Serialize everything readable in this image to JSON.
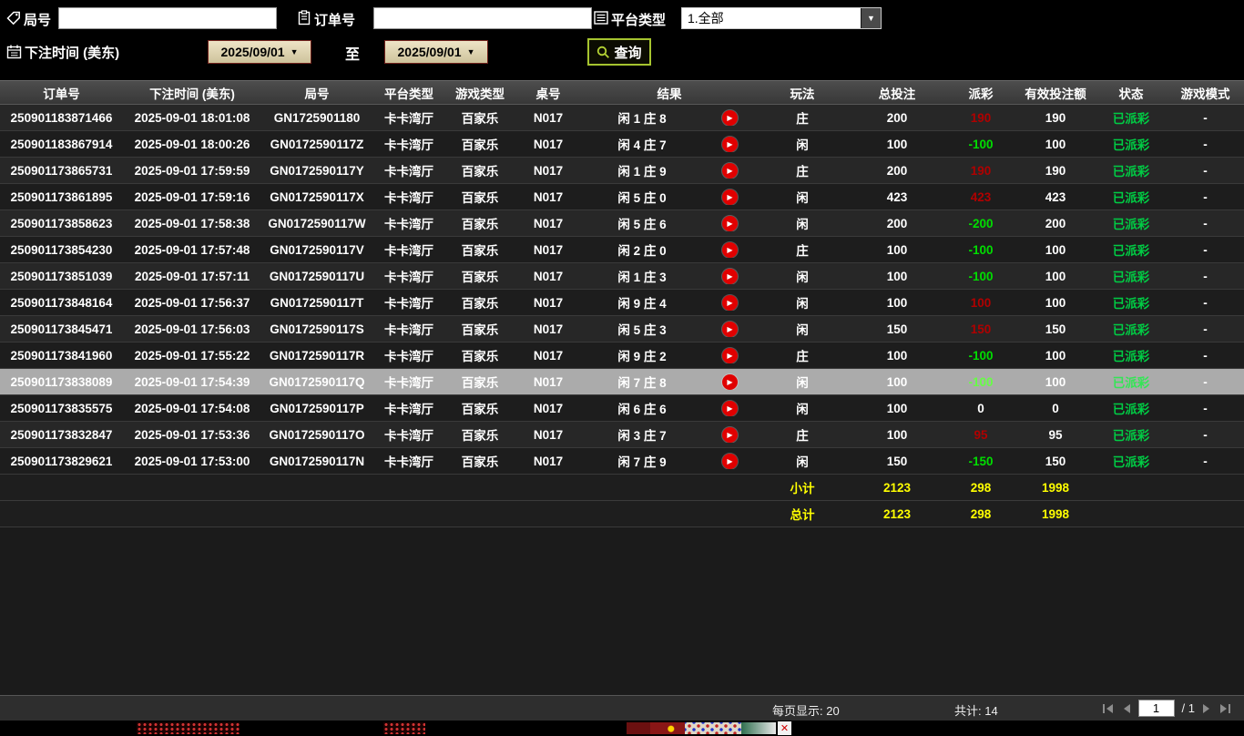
{
  "filters": {
    "round_label": "局号",
    "round_value": "",
    "order_label": "订单号",
    "order_value": "",
    "platform_label": "平台类型",
    "platform_value": "1.全部",
    "bet_time_label": "下注时间 (美东)",
    "date_from": "2025/09/01",
    "to_label": "至",
    "date_to": "2025/09/01",
    "search_label": "查询"
  },
  "icons": {
    "dropdown": "▼",
    "play": "▶",
    "close": "✕"
  },
  "table": {
    "headers": [
      "订单号",
      "下注时间 (美东)",
      "局号",
      "平台类型",
      "游戏类型",
      "桌号",
      "结果",
      "玩法",
      "总投注",
      "派彩",
      "有效投注额",
      "状态",
      "游戏模式"
    ],
    "rows": [
      {
        "order_no": "250901183871466",
        "bet_time": "2025-09-01 18:01:08",
        "round_no": "GN1725901180",
        "platform": "卡卡湾厅",
        "game": "百家乐",
        "table_no": "N017",
        "result": "闲 1 庄 8",
        "play": "庄",
        "total_bet": "200",
        "payout": "190",
        "payout_color": "red",
        "valid_bet": "190",
        "status": "已派彩",
        "mode": "-",
        "selected": false
      },
      {
        "order_no": "250901183867914",
        "bet_time": "2025-09-01 18:00:26",
        "round_no": "GN0172590117Z",
        "platform": "卡卡湾厅",
        "game": "百家乐",
        "table_no": "N017",
        "result": "闲 4 庄 7",
        "play": "闲",
        "total_bet": "100",
        "payout": "-100",
        "payout_color": "green",
        "valid_bet": "100",
        "status": "已派彩",
        "mode": "-",
        "selected": false
      },
      {
        "order_no": "250901173865731",
        "bet_time": "2025-09-01 17:59:59",
        "round_no": "GN0172590117Y",
        "platform": "卡卡湾厅",
        "game": "百家乐",
        "table_no": "N017",
        "result": "闲 1 庄 9",
        "play": "庄",
        "total_bet": "200",
        "payout": "190",
        "payout_color": "red",
        "valid_bet": "190",
        "status": "已派彩",
        "mode": "-",
        "selected": false
      },
      {
        "order_no": "250901173861895",
        "bet_time": "2025-09-01 17:59:16",
        "round_no": "GN0172590117X",
        "platform": "卡卡湾厅",
        "game": "百家乐",
        "table_no": "N017",
        "result": "闲 5 庄 0",
        "play": "闲",
        "total_bet": "423",
        "payout": "423",
        "payout_color": "red",
        "valid_bet": "423",
        "status": "已派彩",
        "mode": "-",
        "selected": false
      },
      {
        "order_no": "250901173858623",
        "bet_time": "2025-09-01 17:58:38",
        "round_no": "GN0172590117W",
        "platform": "卡卡湾厅",
        "game": "百家乐",
        "table_no": "N017",
        "result": "闲 5 庄 6",
        "play": "闲",
        "total_bet": "200",
        "payout": "-200",
        "payout_color": "green",
        "valid_bet": "200",
        "status": "已派彩",
        "mode": "-",
        "selected": false
      },
      {
        "order_no": "250901173854230",
        "bet_time": "2025-09-01 17:57:48",
        "round_no": "GN0172590117V",
        "platform": "卡卡湾厅",
        "game": "百家乐",
        "table_no": "N017",
        "result": "闲 2 庄 0",
        "play": "庄",
        "total_bet": "100",
        "payout": "-100",
        "payout_color": "green",
        "valid_bet": "100",
        "status": "已派彩",
        "mode": "-",
        "selected": false
      },
      {
        "order_no": "250901173851039",
        "bet_time": "2025-09-01 17:57:11",
        "round_no": "GN0172590117U",
        "platform": "卡卡湾厅",
        "game": "百家乐",
        "table_no": "N017",
        "result": "闲 1 庄 3",
        "play": "闲",
        "total_bet": "100",
        "payout": "-100",
        "payout_color": "green",
        "valid_bet": "100",
        "status": "已派彩",
        "mode": "-",
        "selected": false
      },
      {
        "order_no": "250901173848164",
        "bet_time": "2025-09-01 17:56:37",
        "round_no": "GN0172590117T",
        "platform": "卡卡湾厅",
        "game": "百家乐",
        "table_no": "N017",
        "result": "闲 9 庄 4",
        "play": "闲",
        "total_bet": "100",
        "payout": "100",
        "payout_color": "red",
        "valid_bet": "100",
        "status": "已派彩",
        "mode": "-",
        "selected": false
      },
      {
        "order_no": "250901173845471",
        "bet_time": "2025-09-01 17:56:03",
        "round_no": "GN0172590117S",
        "platform": "卡卡湾厅",
        "game": "百家乐",
        "table_no": "N017",
        "result": "闲 5 庄 3",
        "play": "闲",
        "total_bet": "150",
        "payout": "150",
        "payout_color": "red",
        "valid_bet": "150",
        "status": "已派彩",
        "mode": "-",
        "selected": false
      },
      {
        "order_no": "250901173841960",
        "bet_time": "2025-09-01 17:55:22",
        "round_no": "GN0172590117R",
        "platform": "卡卡湾厅",
        "game": "百家乐",
        "table_no": "N017",
        "result": "闲 9 庄 2",
        "play": "庄",
        "total_bet": "100",
        "payout": "-100",
        "payout_color": "green",
        "valid_bet": "100",
        "status": "已派彩",
        "mode": "-",
        "selected": false
      },
      {
        "order_no": "250901173838089",
        "bet_time": "2025-09-01 17:54:39",
        "round_no": "GN0172590117Q",
        "platform": "卡卡湾厅",
        "game": "百家乐",
        "table_no": "N017",
        "result": "闲 7 庄 8",
        "play": "闲",
        "total_bet": "100",
        "payout": "-100",
        "payout_color": "green",
        "valid_bet": "100",
        "status": "已派彩",
        "mode": "-",
        "selected": true
      },
      {
        "order_no": "250901173835575",
        "bet_time": "2025-09-01 17:54:08",
        "round_no": "GN0172590117P",
        "platform": "卡卡湾厅",
        "game": "百家乐",
        "table_no": "N017",
        "result": "闲 6 庄 6",
        "play": "闲",
        "total_bet": "100",
        "payout": "0",
        "payout_color": "white",
        "valid_bet": "0",
        "status": "已派彩",
        "mode": "-",
        "selected": false
      },
      {
        "order_no": "250901173832847",
        "bet_time": "2025-09-01 17:53:36",
        "round_no": "GN0172590117O",
        "platform": "卡卡湾厅",
        "game": "百家乐",
        "table_no": "N017",
        "result": "闲 3 庄 7",
        "play": "庄",
        "total_bet": "100",
        "payout": "95",
        "payout_color": "red",
        "valid_bet": "95",
        "status": "已派彩",
        "mode": "-",
        "selected": false
      },
      {
        "order_no": "250901173829621",
        "bet_time": "2025-09-01 17:53:00",
        "round_no": "GN0172590117N",
        "platform": "卡卡湾厅",
        "game": "百家乐",
        "table_no": "N017",
        "result": "闲 7 庄 9",
        "play": "闲",
        "total_bet": "150",
        "payout": "-150",
        "payout_color": "green",
        "valid_bet": "150",
        "status": "已派彩",
        "mode": "-",
        "selected": false
      }
    ],
    "subtotal": {
      "label": "小计",
      "total_bet": "2123",
      "payout": "298",
      "valid_bet": "1998"
    },
    "total": {
      "label": "总计",
      "total_bet": "2123",
      "payout": "298",
      "valid_bet": "1998"
    }
  },
  "footer": {
    "per_page": "每页显示: 20",
    "total_count": "共计: 14",
    "page_value": "1",
    "page_total": "/  1"
  },
  "colors": {
    "payout_win_red": "#b00000",
    "payout_lose_green": "#00dd00",
    "status_green": "#00cc44",
    "summary_yellow": "#ffff00",
    "selected_row_gray": "#ababab",
    "search_border_green": "#a6c42f",
    "date_button_tan": "#dcd2ab"
  }
}
